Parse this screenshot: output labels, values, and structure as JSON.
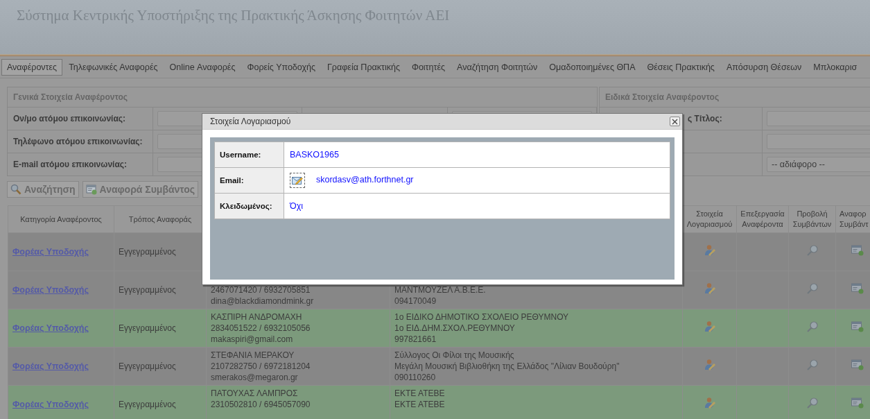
{
  "header": {
    "title": "Σύστημα Κεντρικής Υποστήριξης της Πρακτικής Άσκησης Φοιτητών ΑΕΙ"
  },
  "nav": [
    {
      "label": "Αναφέροντες",
      "selected": true
    },
    {
      "label": "Τηλεφωνικές Αναφορές",
      "selected": false
    },
    {
      "label": "Online Αναφορές",
      "selected": false
    },
    {
      "label": "Φορείς Υποδοχής",
      "selected": false
    },
    {
      "label": "Γραφεία Πρακτικής",
      "selected": false
    },
    {
      "label": "Φοιτητές",
      "selected": false
    },
    {
      "label": "Αναζήτηση Φοιτητών",
      "selected": false
    },
    {
      "label": "Ομαδοποιημένες ΘΠΑ",
      "selected": false
    },
    {
      "label": "Θέσεις Πρακτικής",
      "selected": false
    },
    {
      "label": "Απόσυρση Θέσεων",
      "selected": false
    },
    {
      "label": "Μπλοκαρισ",
      "selected": false
    }
  ],
  "filters": {
    "general": {
      "title": "Γενικά Στοιχεία Αναφέροντος",
      "labels": [
        "Ον/μο ατόμου επικοινωνίας:",
        "Τηλέφωνο ατόμου επικοινωνίας:",
        "E-mail ατόμου επικοινωνίας:"
      ]
    },
    "specific": {
      "title": "Ειδικά Στοιχεία Αναφέροντος",
      "label": "ς Τίτλος:",
      "select_value": "-- αδιάφορο --"
    }
  },
  "buttons": [
    {
      "label": "Αναζήτηση",
      "kind": "search"
    },
    {
      "label": "Αναφορά Συμβάντος",
      "kind": "report"
    }
  ],
  "table": {
    "columns": [
      "Κατηγορία Αναφέροντος",
      "Τρόπος Αναφοράς",
      "Στοιχεία Λογαριασμού",
      "Επεξεργασία Αναφέροντα",
      "Προβολή Συμβάντων",
      "Αναφορ Συμβάντ"
    ],
    "rows": [
      {
        "highlighted": false,
        "category": "Φορέας Υποδοχής",
        "method": "Εγγεγραμμένος"
      },
      {
        "highlighted": false,
        "category": "Φορέας Υποδοχής",
        "method": "Εγγεγραμμένος",
        "column_3": [
          "2467071420 / 6932705851",
          "dina@blackdiamondmink.gr"
        ],
        "column_4": [
          "ΜΑΝΤΜΟΥΖΕΛ Α.Β.Ε.Ε.",
          "094170049"
        ]
      },
      {
        "highlighted": true,
        "category": "Φορέας Υποδοχής",
        "method": "Εγγεγραμμένος",
        "column_3": [
          "ΚΑΣΠΙΡΗ ΑΝΔΡΟΜΑΧΗ",
          "2834051522 / 6932105056",
          "makaspiri@gmail.com"
        ],
        "column_4": [
          "1ο ΕΙΔΙΚΟ ΔΗΜΟΤΙΚΟ ΣΧΟΛΕΙΟ ΡΕΘΥΜΝΟΥ",
          "1ο ΕΙΔ.ΔΗΜ.ΣΧΟΛ.ΡΕΘΥΜΝΟΥ",
          "997821661"
        ]
      },
      {
        "highlighted": false,
        "category": "Φορέας Υποδοχής",
        "method": "Εγγεγραμμένος",
        "column_3": [
          "ΣΤΕΦΑΝΙΑ ΜΕΡΑΚΟΥ",
          "2107282750 / 6972181204",
          "smerakos@megaron.gr"
        ],
        "column_4": [
          "Σύλλογος Οι Φίλοι της Μουσικής",
          "Μεγάλη Μουσική Βιβλιοθήκη της Ελλάδος \"Λίλιαν Βουδούρη\"",
          "090110260"
        ]
      },
      {
        "highlighted": true,
        "category": "Φορέας Υποδοχής",
        "method": "Εγγεγραμμένος",
        "column_3": [
          "ΠΑΤΟΥΧΑΣ ΛΑΜΠΡΟΣ",
          "2310502810 / 6945057090"
        ],
        "column_4": [
          "ΕΚΤΕ ΑΤΕΒΕ",
          "ΕΚΤΕ ΑΤΕΒΕ"
        ]
      }
    ]
  },
  "dialog": {
    "title": "Στοιχεία Λογαριασμού",
    "fields": [
      {
        "label": "Username:",
        "value": "BASKO1965",
        "kind": "text"
      },
      {
        "label": "Email:",
        "value": "skordasv@ath.forthnet.gr",
        "kind": "email"
      },
      {
        "label": "Κλειδωμένος:",
        "value": "Όχι",
        "kind": "text"
      }
    ]
  }
}
